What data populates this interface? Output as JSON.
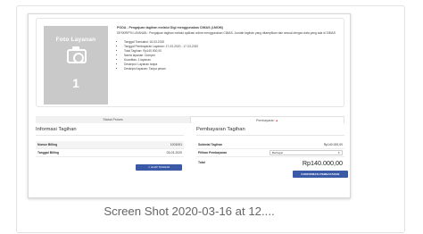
{
  "photo": {
    "label": "Foto Layanan",
    "number": "1"
  },
  "info": {
    "title": "PODA - Pengajuan tagihan melalui Digi menggunakan CIMAS (LMOM)",
    "description": "DESKRIPSI LAYANAN : Pengajuan tagihan melalui aplikasi online menggunakan CIMAS. Jumlah tagihan yang ditampilkan dan sesuai dengan data yang ada di SIMAS",
    "items": [
      "Tanggal Transaksi: 16-03-2020",
      "Tanggal Pembayaran Layanan: 17-03-2020 - 17-03-2020",
      "Total Tagihan: Rp140.000,00",
      "Nama layanan: Dompet",
      "Kuantitas: 1 layanan",
      "Deskripsi: Layanan tanpa",
      "Deskripsi layanan: Tanpa pesan"
    ]
  },
  "tabs": {
    "status": "Status Proses",
    "payment": "Pembayaran",
    "payment_warning": "▲"
  },
  "left": {
    "heading": "Informasi Tagihan",
    "rows": [
      {
        "key": "Nomor Billing",
        "value": "1001001"
      },
      {
        "key": "Tanggal Billing",
        "value": "03-03-2020"
      }
    ],
    "view_button": "⇩ LIHAT TAGIHAN"
  },
  "right": {
    "heading": "Pembayaran Tagihan",
    "subtotal_label": "Subtotal Tagihan",
    "subtotal_value": "Rp140.000,00",
    "method_label": "Pilihan Pembayaran",
    "method_value": "Berbayar",
    "total_label": "Total",
    "total_value": "Rp140.000,00",
    "confirm_button": "KONFIRMASI PEMBAYARAN"
  },
  "caption": "Screen Shot 2020-03-16 at 12...."
}
